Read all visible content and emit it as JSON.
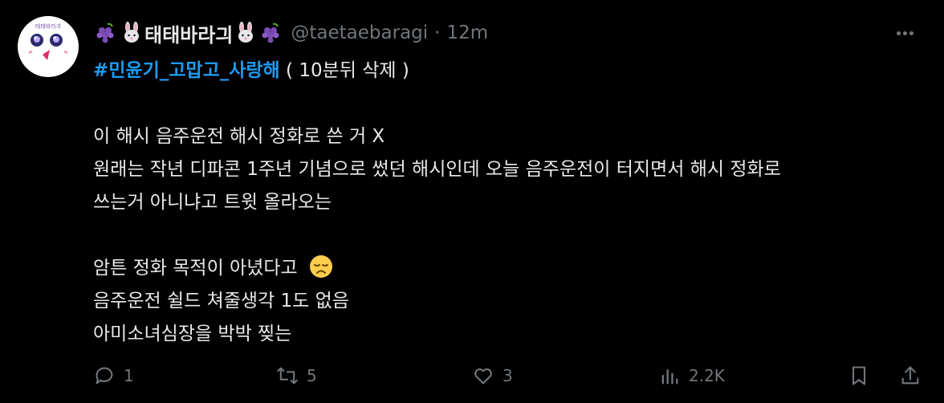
{
  "tweet": {
    "author": {
      "display_name": "태태바라긔",
      "handle": "@taetaebaragi",
      "avatar_text": "태태바라긔",
      "name_emojis": [
        "grapes-icon",
        "rabbit-face-icon",
        "rabbit-face-icon",
        "grapes-icon"
      ]
    },
    "separator": "·",
    "time": "12m",
    "hashtag": "#민윤기_고맙고_사랑해",
    "hashtag_suffix": " ( 10분뒤 삭제 )",
    "body_lines": [
      "이 해시 음주운전 해시 정화로 쓴 거 X",
      "원래는 작년 디파콘 1주년 기념으로 썼던 해시인데 오늘 음주운전이 터지면서 해시 정화로",
      "쓰는거 아니냐고 트윗 올라오는"
    ],
    "body_lines_2": [
      "암튼 정화 목적이 아녔다고",
      "음주운전 쉴드 쳐줄생각 1도 없음",
      "아미소녀심장을 박박 찢는"
    ],
    "inline_emoji": "disappointed-face-icon",
    "actions": {
      "replies": "1",
      "reposts": "5",
      "likes": "3",
      "views": "2.2K"
    }
  },
  "colors": {
    "background": "#000000",
    "text": "#e7e9ea",
    "muted": "#71767b",
    "link": "#1d9bf0"
  }
}
